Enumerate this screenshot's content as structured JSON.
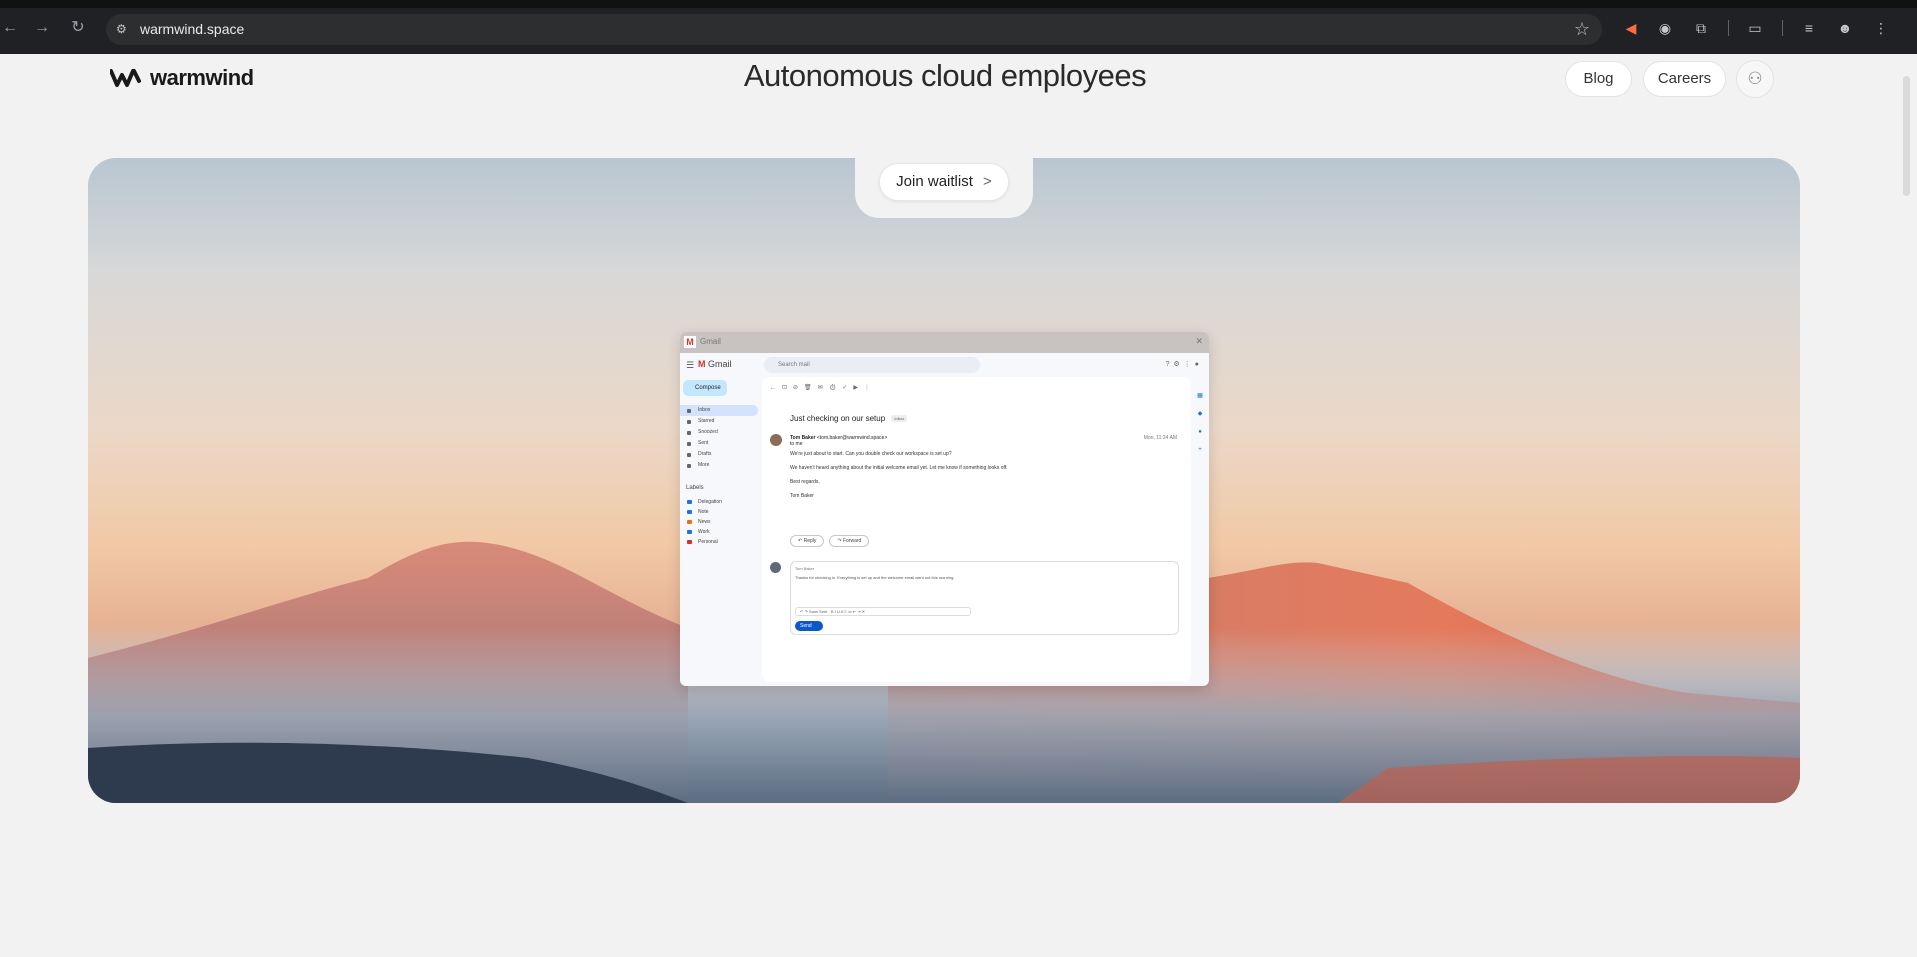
{
  "browser": {
    "url": "warmwind.space",
    "back_icon": "back-arrow-icon",
    "forward_icon": "forward-arrow-icon",
    "reload_icon": "reload-icon"
  },
  "site": {
    "logo_text": "warmwind",
    "headline": "Autonomous cloud employees",
    "nav": {
      "blog": "Blog",
      "careers": "Careers"
    },
    "cta": "Join waitlist",
    "cta_chevron": ">"
  },
  "gmail": {
    "tab_title": "Gmail",
    "brand": "Gmail",
    "search_placeholder": "Search mail",
    "compose": "Compose",
    "nav": [
      "Inbox",
      "Starred",
      "Snoozed",
      "Sent",
      "Drafts",
      "More"
    ],
    "labels_title": "Labels",
    "labels": [
      {
        "name": "Delegation",
        "color": "#1a73e8"
      },
      {
        "name": "Note",
        "color": "#1a73e8"
      },
      {
        "name": "News",
        "color": "#e8710a"
      },
      {
        "name": "Work",
        "color": "#1a73e8"
      },
      {
        "name": "Personal",
        "color": "#d93025"
      }
    ],
    "subject": "Just checking on our setup",
    "subject_tag": "Inbox",
    "sender_name": "Tom Baker",
    "sender_rest": "<tom.baker@warmwind.space>",
    "sender_to": "to me",
    "date": "Mon, 11:24 AM",
    "body": [
      "We're just about to start. Can you double check our workspace is set up?",
      "We haven't heard anything about the initial welcome email yet. Let me know if something looks off.",
      "Best regards,",
      "Tom Baker"
    ],
    "reply_btn": "Reply",
    "forward_btn": "Forward",
    "reply_to": "Tom Baker",
    "reply_text": "Thanks for checking in. Everything is set up and the welcome email went out this morning.",
    "send_btn": "Send"
  }
}
